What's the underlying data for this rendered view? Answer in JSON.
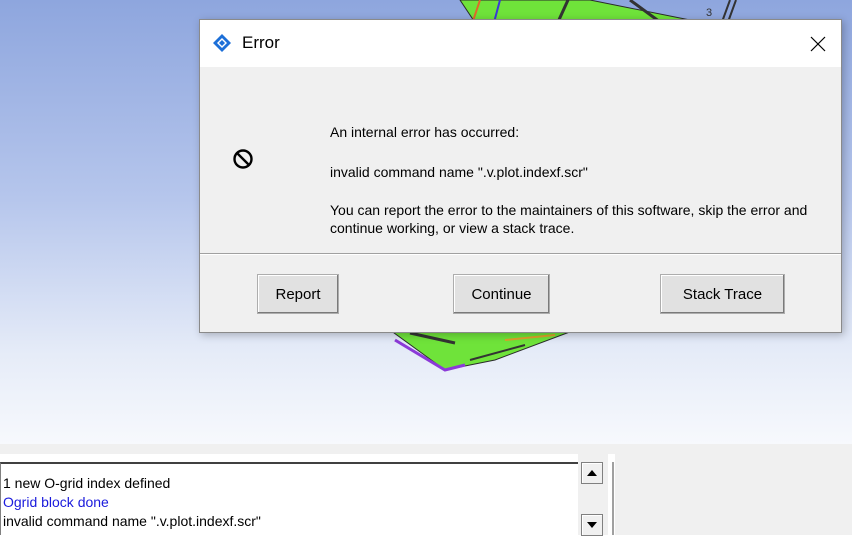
{
  "dialog": {
    "title": "Error",
    "close_glyph": "✕",
    "message_line1": "An internal error has occurred:",
    "message_line2": "invalid command name \".v.plot.indexf.scr\"",
    "message_line3": "You can report the error to the maintainers of this software, skip the error and continue working, or view a stack trace.",
    "buttons": {
      "report": "Report",
      "continue": "Continue",
      "stack_trace": "Stack Trace"
    },
    "icons": {
      "title": "diamond-app-icon",
      "body": "stop-icon"
    }
  },
  "console": {
    "lines": [
      {
        "text": "1 new O-grid index defined",
        "color": "#000000"
      },
      {
        "text": "Ogrid block done",
        "color": "#1a1adc"
      },
      {
        "text": "invalid command name \".v.plot.indexf.scr\"",
        "color": "#000000"
      }
    ]
  },
  "viewport": {
    "model_label": "3"
  },
  "colors": {
    "model_green": "#6fe33a",
    "viewport_top": "#8ea6de",
    "dialog_bg": "#f0f0f0"
  }
}
